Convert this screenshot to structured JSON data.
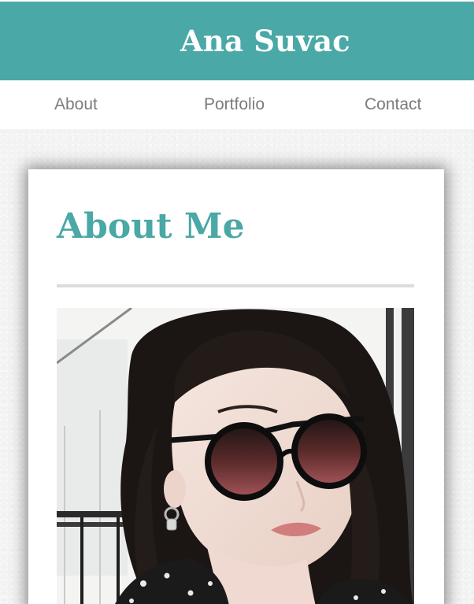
{
  "header": {
    "site_title": "Ana Suvac",
    "background_color": "#4aa8a6"
  },
  "nav": {
    "items": [
      {
        "label": "About"
      },
      {
        "label": "Portfolio"
      },
      {
        "label": "Contact"
      }
    ],
    "text_color": "#7c7c7c"
  },
  "main": {
    "heading": "About Me",
    "heading_color": "#4aa8a6",
    "photo": {
      "subject_icon": "portrait-photo"
    }
  }
}
